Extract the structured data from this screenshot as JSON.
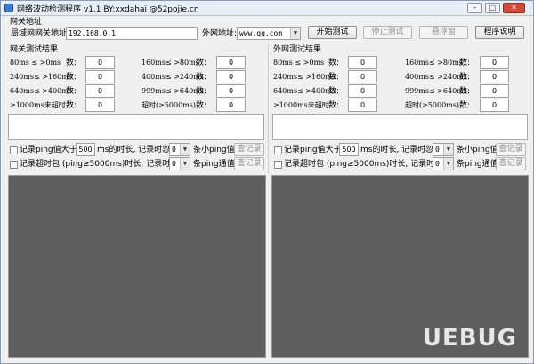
{
  "window": {
    "title": "网络波动检测程序 v1.1  BY:xxdahai  @52pojie.cn",
    "min_glyph": "–",
    "max_glyph": "□",
    "close_glyph": "✕"
  },
  "gateway": {
    "group_label": "网关地址",
    "lan_label": "局域网网关地址:",
    "lan_value": "192.168.0.1",
    "wan_label": "外网地址:",
    "wan_value": "www.qq.com"
  },
  "toolbar": {
    "start_label": "开始测试",
    "stop_label": "停止测试",
    "float_label": "悬浮窗",
    "about_label": "程序说明"
  },
  "lan_results": {
    "header": "网关测试结果",
    "rows_left": [
      {
        "label": "80ms ≤ >0ms",
        "count_label": "数:",
        "value": "0"
      },
      {
        "label": "240ms≤ >160ms",
        "count_label": "数:",
        "value": "0"
      },
      {
        "label": "640ms≤ >400ms",
        "count_label": "数:",
        "value": "0"
      },
      {
        "label": "≥1000ms未超时",
        "count_label": "数:",
        "value": "0"
      }
    ],
    "rows_right": [
      {
        "label": "160ms≤ >80ms",
        "count_label": "数:",
        "value": "0"
      },
      {
        "label": "400ms≤ >240ms",
        "count_label": "数:",
        "value": "0"
      },
      {
        "label": "999ms≤ >640ms",
        "count_label": "数:",
        "value": "0"
      },
      {
        "label": "超时(≥5000ms)",
        "count_label": "数:",
        "value": "0"
      }
    ],
    "record1": {
      "prefix": "记录ping值大于:",
      "value": "500",
      "middle": "ms的时长, 记录时忽略",
      "select": "0",
      "suffix": "条小ping值",
      "button": "查记录"
    },
    "record2": {
      "prefix": "记录超时包 (ping≥5000ms)时长, 记录时忽略",
      "select": "0",
      "suffix": "条ping通值",
      "button": "查记录"
    }
  },
  "wan_results": {
    "header": "外网测试结果",
    "rows_left": [
      {
        "label": "80ms ≤ >0ms",
        "count_label": "数:",
        "value": "0"
      },
      {
        "label": "240ms≤ >160ms",
        "count_label": "数:",
        "value": "0"
      },
      {
        "label": "640ms≤ >400ms",
        "count_label": "数:",
        "value": "0"
      },
      {
        "label": "≥1000ms未超时",
        "count_label": "数:",
        "value": "0"
      }
    ],
    "rows_right": [
      {
        "label": "160ms≤ >80ms",
        "count_label": "数:",
        "value": "0"
      },
      {
        "label": "400ms≤ >240ms",
        "count_label": "数:",
        "value": "0"
      },
      {
        "label": "999ms≤ >640ms",
        "count_label": "数:",
        "value": "0"
      },
      {
        "label": "超时(≥5000ms)",
        "count_label": "数:",
        "value": "0"
      }
    ],
    "record1": {
      "prefix": "记录ping值大于:",
      "value": "500",
      "middle": "ms的时长, 记录时忽略",
      "select": "0",
      "suffix": "条小ping值",
      "button": "查记录"
    },
    "record2": {
      "prefix": "记录超时包 (ping≥5000ms)时长, 记录时忽略",
      "select": "0",
      "suffix": "条ping通值",
      "button": "查记录"
    }
  },
  "watermark": "UEBUG"
}
